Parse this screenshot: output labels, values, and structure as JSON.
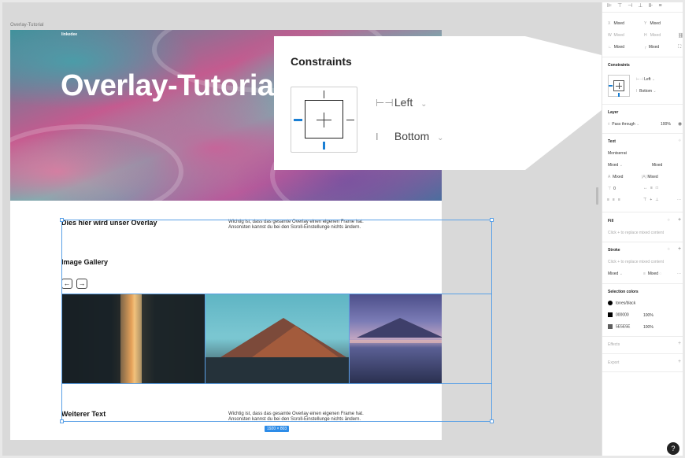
{
  "canvas": {
    "frame_label": "Overlay-Tutorial",
    "hero": {
      "logo": "linkedee",
      "title": "Overlay-Tutorial"
    },
    "sections": [
      {
        "heading": "Dies  hier wird unser Overlay",
        "body": "Wichtig ist, dass das gesamte Overlay einen eigenen Frame hat. Ansonsten kannst du bei den Scroll-Einstellunge nichts ändern."
      },
      {
        "heading": "Image Gallery"
      },
      {
        "heading": "Weiterer Text",
        "body": "Wichtig ist, dass das gesamte Overlay einen eigenen Frame hat. Ansonsten kannst du bei den Scroll-Einstellunge nichts ändern."
      }
    ],
    "nav": {
      "prev": "←",
      "next": "→"
    },
    "size_badge": "1920 × 803"
  },
  "callout": {
    "title": "Constraints",
    "horizontal": "Left",
    "vertical": "Bottom",
    "horizontal_icon": "horizontal-constraint-icon",
    "vertical_icon": "vertical-constraint-icon"
  },
  "panel": {
    "position": {
      "x": "Mixed",
      "y": "Mixed",
      "w": "Mixed",
      "h": "Mixed",
      "rotation": "Mixed",
      "radius": "Mixed"
    },
    "constraints": {
      "title": "Constraints",
      "horizontal": "Left",
      "vertical": "Bottom"
    },
    "layer": {
      "title": "Layer",
      "blend": "Pass through",
      "opacity": "100%"
    },
    "text": {
      "title": "Text",
      "font": "Montserrat",
      "weight": "Mixed",
      "size": "Mixed",
      "line_height": "Mixed",
      "letter_spacing": "Mixed",
      "paragraph": "0"
    },
    "fill": {
      "title": "Fill",
      "hint": "Click + to replace mixed content"
    },
    "stroke": {
      "title": "Stroke",
      "hint": "Click + to replace mixed content",
      "weight": "Mixed",
      "align": "Mixed"
    },
    "selection_colors": {
      "title": "Selection colors",
      "items": [
        {
          "name": "tones/black",
          "color": "#000000",
          "opacity": ""
        },
        {
          "name": "000000",
          "color": "#000000",
          "opacity": "100%"
        },
        {
          "name": "5E5E5E",
          "color": "#5e5e5e",
          "opacity": "100%"
        }
      ]
    },
    "effects": {
      "title": "Effects"
    },
    "export": {
      "title": "Export"
    },
    "help": "?"
  },
  "colors": {
    "accent": "#1a7fd4",
    "selection": "#5aa0e6"
  }
}
